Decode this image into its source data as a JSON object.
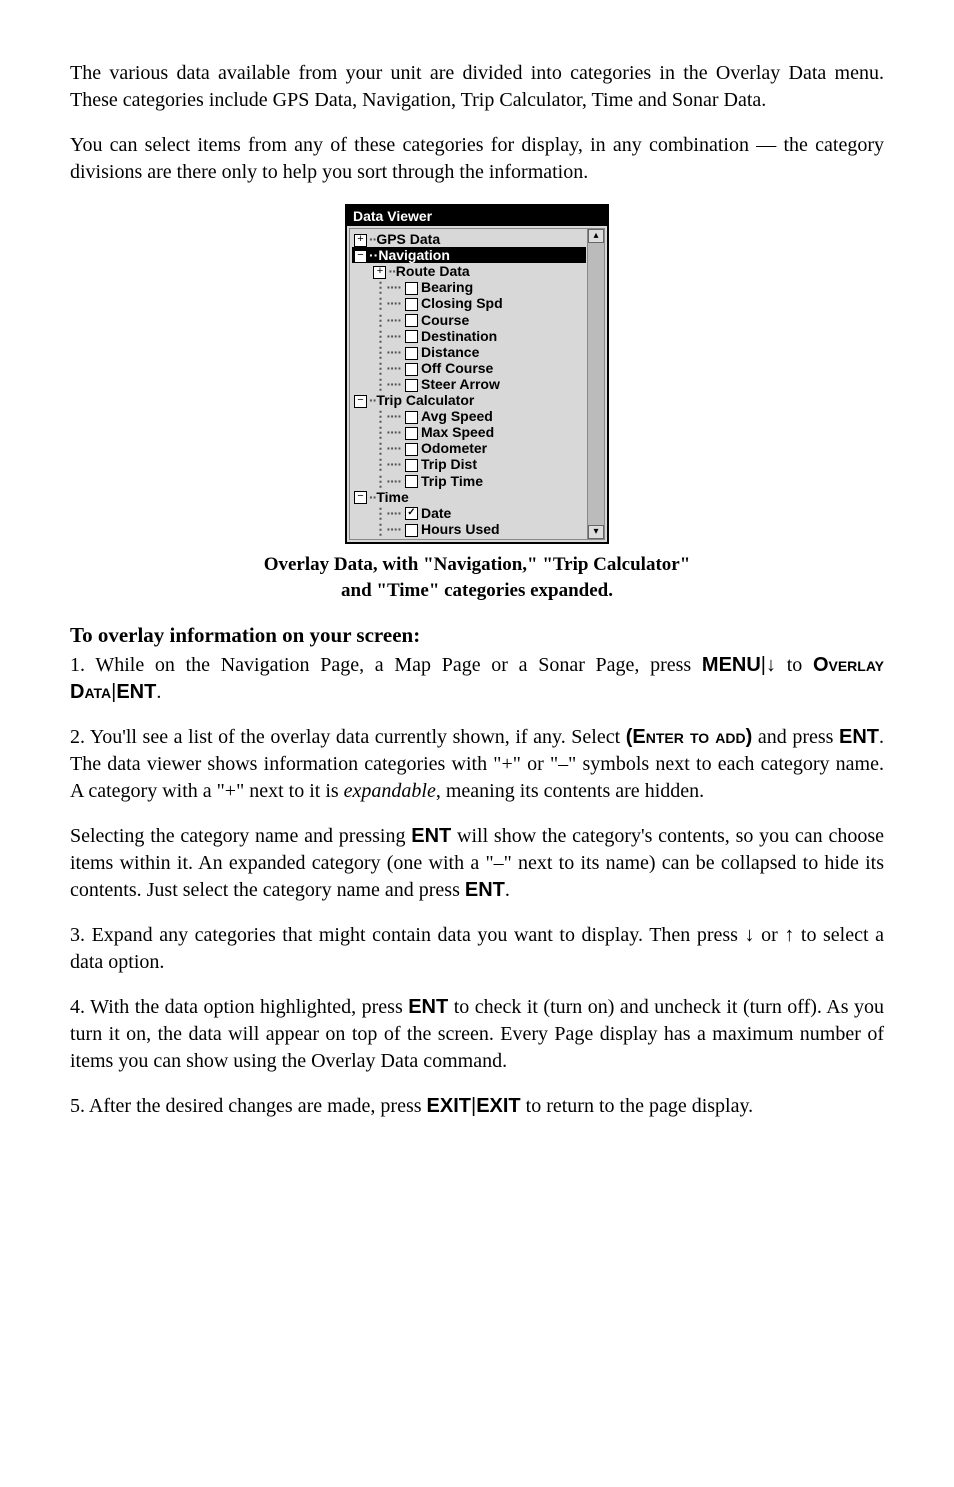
{
  "intro1": "The various data available from your unit are divided into categories in the Overlay Data menu. These categories include GPS Data, Navigation, Trip Calculator, Time and Sonar Data.",
  "intro2": "You can select items from any of these categories for display, in any combination — the category divisions are there only to help you sort through the information.",
  "viewer": {
    "title": "Data Viewer",
    "gps": "GPS Data",
    "navigation": "Navigation",
    "routeData": "Route Data",
    "bearing": "Bearing",
    "closingSpd": "Closing Spd",
    "course": "Course",
    "destination": "Destination",
    "distance": "Distance",
    "offCourse": "Off Course",
    "steerArrow": "Steer Arrow",
    "tripCalc": "Trip Calculator",
    "avgSpeed": "Avg Speed",
    "maxSpeed": "Max Speed",
    "odometer": "Odometer",
    "tripDist": "Trip Dist",
    "tripTime": "Trip Time",
    "time": "Time",
    "date": "Date",
    "hoursUsed": "Hours Used"
  },
  "caption1": "Overlay Data, with \"Navigation,\" \"Trip Calculator\"",
  "caption2": "and \"Time\" categories expanded.",
  "sectHead": "To overlay information on your screen:",
  "step1a": "1. While on the Navigation Page, a Map Page or a Sonar Page, press ",
  "menu": "MENU",
  "pipe": "|",
  "to": " to ",
  "overlayData": "Overlay Data",
  "ent": "ENT",
  "dot": ".",
  "step2a": "2. You'll see a list of the overlay data currently shown, if any. Select ",
  "enterToAdd": "(Enter to add)",
  "step2b": " and press ",
  "step2c": ". The data viewer shows information categories with \"+\" or \"–\" symbols next to each category name. A category with a \"+\" next to it is ",
  "expandable": "expandable",
  "step2d": ", meaning its contents are hidden.",
  "para3a": "Selecting the category name and pressing ",
  "para3b": " will show the category's contents, so you can choose items within it. An expanded category (one with a \"–\" next to its name) can be collapsed to hide its contents. Just select the category name and press ",
  "step3a": "3. Expand any categories that might contain data you want to display. Then press ",
  "or": " or ",
  "step3b": " to select a data option.",
  "step4a": "4. With the data option highlighted, press ",
  "step4b": " to check it (turn on) and uncheck it (turn off). As you turn it on, the data will appear on top of the screen. Every Page display has a maximum number of items you can show using the Overlay Data command.",
  "step5a": "5. After the desired changes are made, press ",
  "exit": "EXIT",
  "step5b": " to return to the page display."
}
